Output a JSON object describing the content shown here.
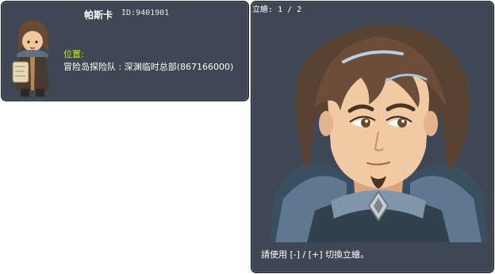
{
  "npc": {
    "name": "帕斯卡",
    "id_text": "ID:9401901",
    "location_label": "位置:",
    "location_value": "冒险岛探险队 : 深渊临时总部(867166000)"
  },
  "portrait": {
    "title": "立繪: 1 / 2",
    "hint": "請使用 [-] / [+] 切換立繪。"
  },
  "colors": {
    "panel_bg": "#3e4753",
    "location_label": "#c8f000",
    "text": "#ffffff"
  }
}
